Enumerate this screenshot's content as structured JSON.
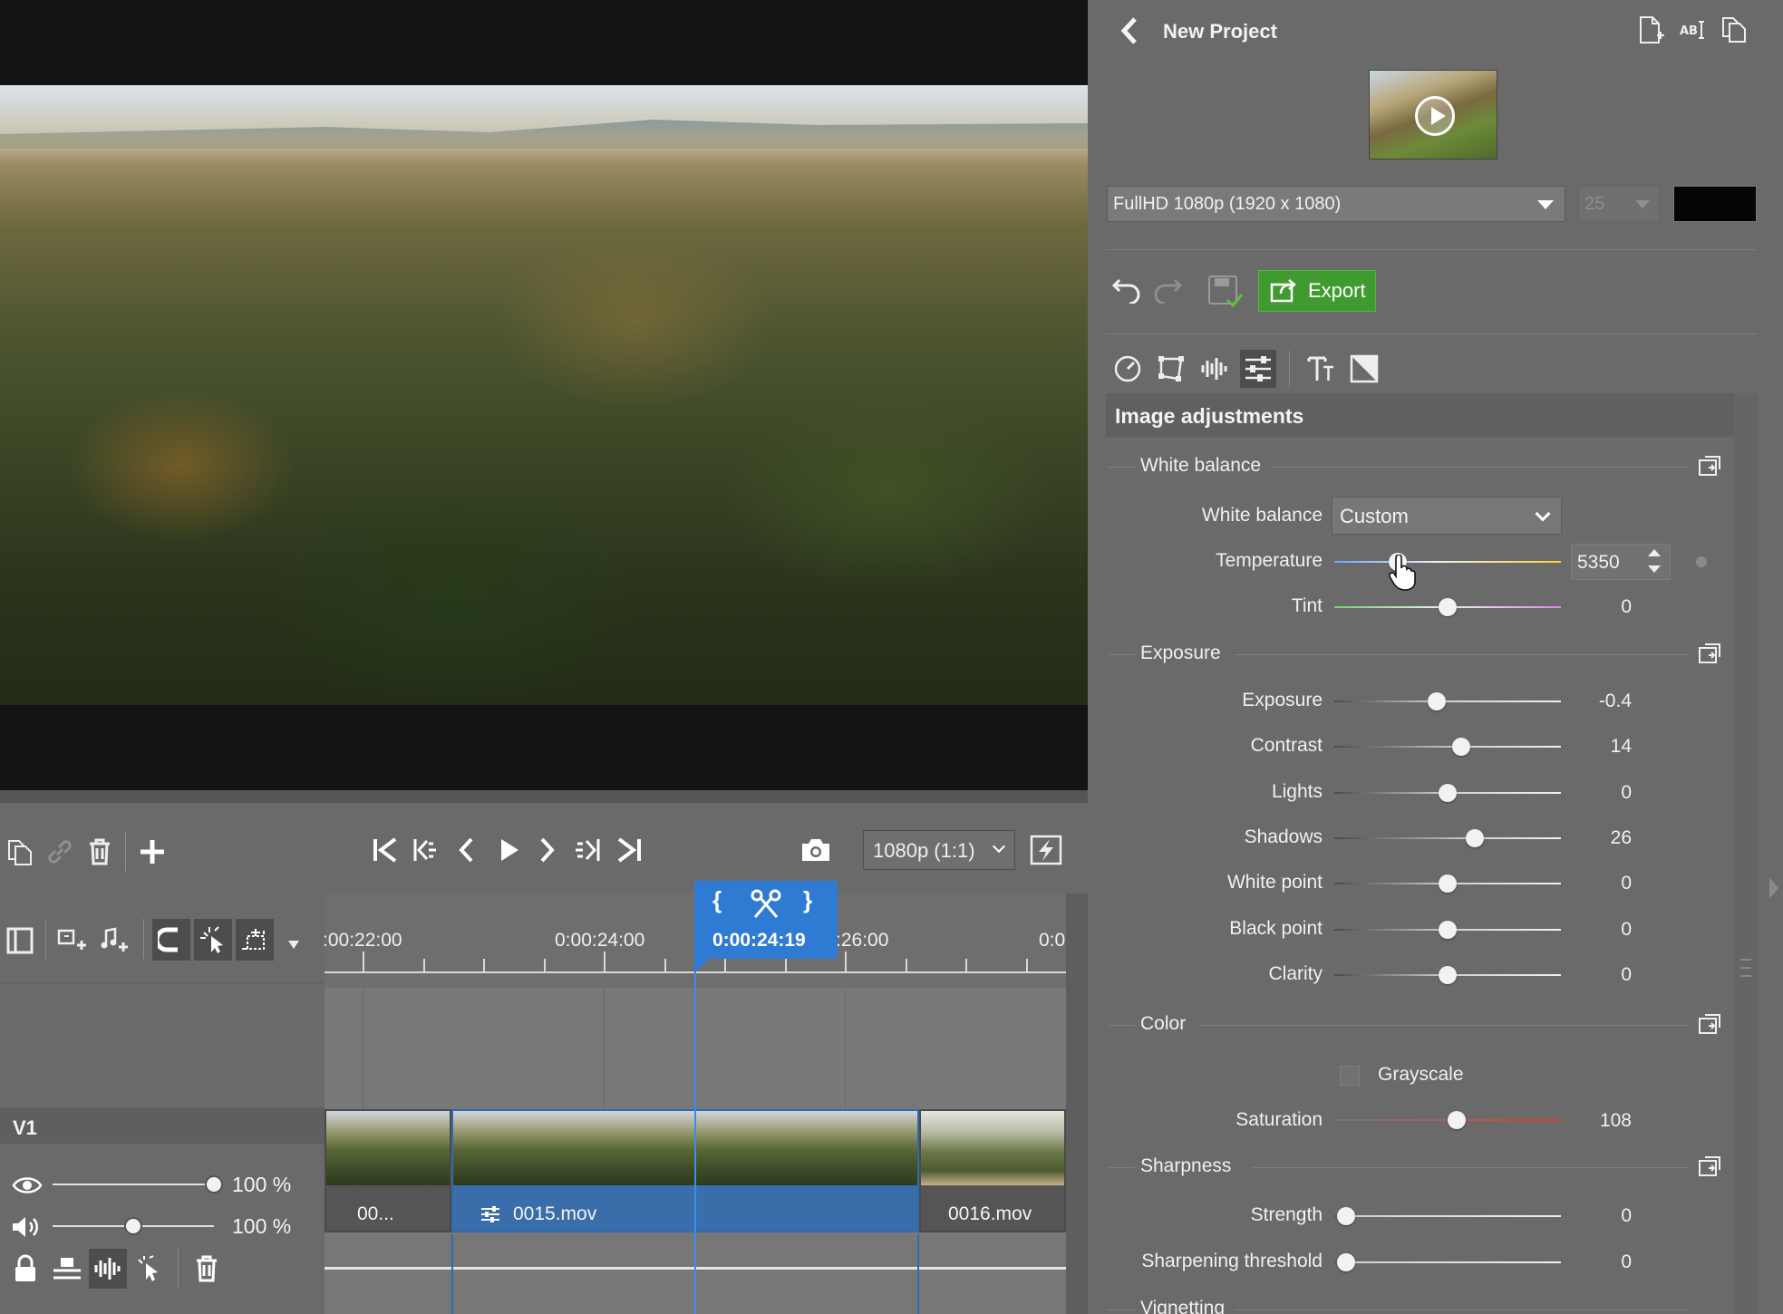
{
  "project": {
    "title": "New Project",
    "resolution": "FullHD 1080p (1920 x 1080)",
    "fps": "25",
    "bg_color": "#000000"
  },
  "header_icons": [
    "new-project-icon",
    "rename-icon",
    "duplicate-icon"
  ],
  "toolbar": {
    "export_label": "Export",
    "accent": "#3f9b30"
  },
  "tool_tabs": [
    "speed-icon",
    "transform-icon",
    "audio-icon",
    "adjustments-icon",
    "text-icon",
    "transition-icon"
  ],
  "adjustments": {
    "title": "Image adjustments",
    "white_balance_section": "White balance",
    "white_balance_label": "White balance",
    "white_balance_value": "Custom",
    "temperature": {
      "label": "Temperature",
      "value": "5350",
      "position": 0.28
    },
    "tint": {
      "label": "Tint",
      "value": "0",
      "position": 0.5
    },
    "exposure_section": "Exposure",
    "exposure_rows": [
      {
        "label": "Exposure",
        "value": "-0.4",
        "position": 0.45
      },
      {
        "label": "Contrast",
        "value": "14",
        "position": 0.56
      },
      {
        "label": "Lights",
        "value": "0",
        "position": 0.5
      },
      {
        "label": "Shadows",
        "value": "26",
        "position": 0.62
      },
      {
        "label": "White point",
        "value": "0",
        "position": 0.5
      },
      {
        "label": "Black point",
        "value": "0",
        "position": 0.5
      },
      {
        "label": "Clarity",
        "value": "0",
        "position": 0.5
      }
    ],
    "color_section": "Color",
    "grayscale_label": "Grayscale",
    "grayscale_checked": false,
    "saturation": {
      "label": "Saturation",
      "value": "108",
      "position": 0.54
    },
    "sharpness_section": "Sharpness",
    "sharpness_rows": [
      {
        "label": "Strength",
        "value": "0",
        "position": 0.05
      },
      {
        "label": "Sharpening threshold",
        "value": "0",
        "position": 0.05
      }
    ],
    "vignetting_section": "Vignetting"
  },
  "playback": {
    "quality": "1080p (1:1)"
  },
  "timeline": {
    "time_labels": [
      ":00:22:00",
      "0:00:24:00",
      ":26:00",
      "0:0"
    ],
    "playhead_time": "0:00:24:19",
    "mark_in": "{",
    "mark_out": "}",
    "track_name": "V1",
    "video_opacity": "100 %",
    "video_opacity_level": 1.0,
    "audio_volume": "100 %",
    "audio_volume_level": 0.5,
    "clips": [
      {
        "name": "00...",
        "selected": false
      },
      {
        "name": "0015.mov",
        "selected": true
      },
      {
        "name": "0016.mov",
        "selected": false
      }
    ]
  }
}
